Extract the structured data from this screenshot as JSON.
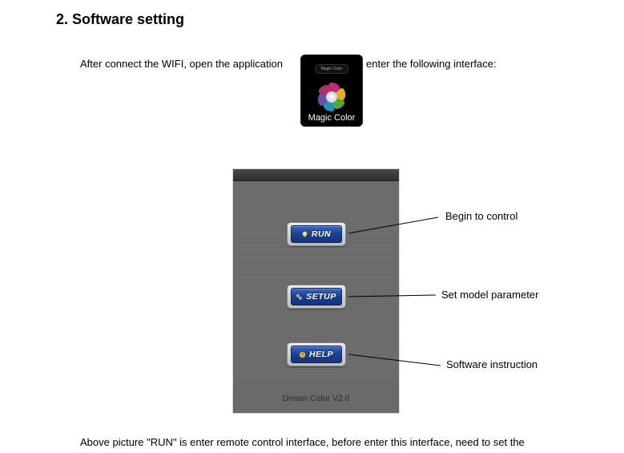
{
  "heading": "2. Software setting",
  "intro": {
    "left": "After connect the WIFI, open the application",
    "right": "enter the following interface:"
  },
  "app_icon": {
    "label": "Magic Color",
    "pill": "Magic Color"
  },
  "phone": {
    "status_visible": true,
    "buttons": {
      "run": {
        "label": "RUN"
      },
      "setup": {
        "label": "SETUP"
      },
      "help": {
        "label": "HELP"
      }
    },
    "version": "Dream Color V2.0"
  },
  "callouts": {
    "run": "Begin to control",
    "setup": "Set model parameter",
    "help": "Software instruction"
  },
  "bottom": "Above picture \"RUN\" is enter remote control interface, before enter this interface, need to set the"
}
